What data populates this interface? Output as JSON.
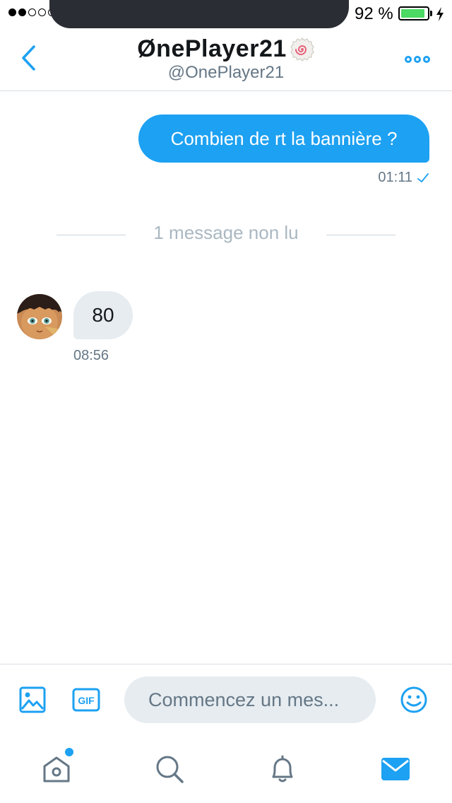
{
  "status_bar": {
    "battery_percent": "92 %",
    "battery_level": 0.92,
    "signal_strength": 2,
    "signal_total": 5
  },
  "header": {
    "display_name": "ØnePlayer21",
    "handle": "@OnePlayer21",
    "icons": {
      "back": "chevron-left-icon",
      "more": "more-dots-icon"
    }
  },
  "conversation": {
    "outgoing": {
      "text": "Combien de rt la bannière ?",
      "time": "01:11"
    },
    "unread_divider": "1 message non lu",
    "incoming": {
      "text": "80",
      "time": "08:56"
    }
  },
  "composer": {
    "placeholder": "Commencez un mes...",
    "gif_label": "GIF"
  },
  "tabbar": {
    "items": [
      "home-icon",
      "search-icon",
      "notifications-bell-icon",
      "messages-envelope-icon"
    ],
    "active": "messages-envelope-icon"
  },
  "colors": {
    "accent": "#1da1f2",
    "bubble_in": "#e6ecf0",
    "muted_text": "#657786",
    "divider_text": "#aab8c2",
    "battery_green": "#4cd964"
  }
}
